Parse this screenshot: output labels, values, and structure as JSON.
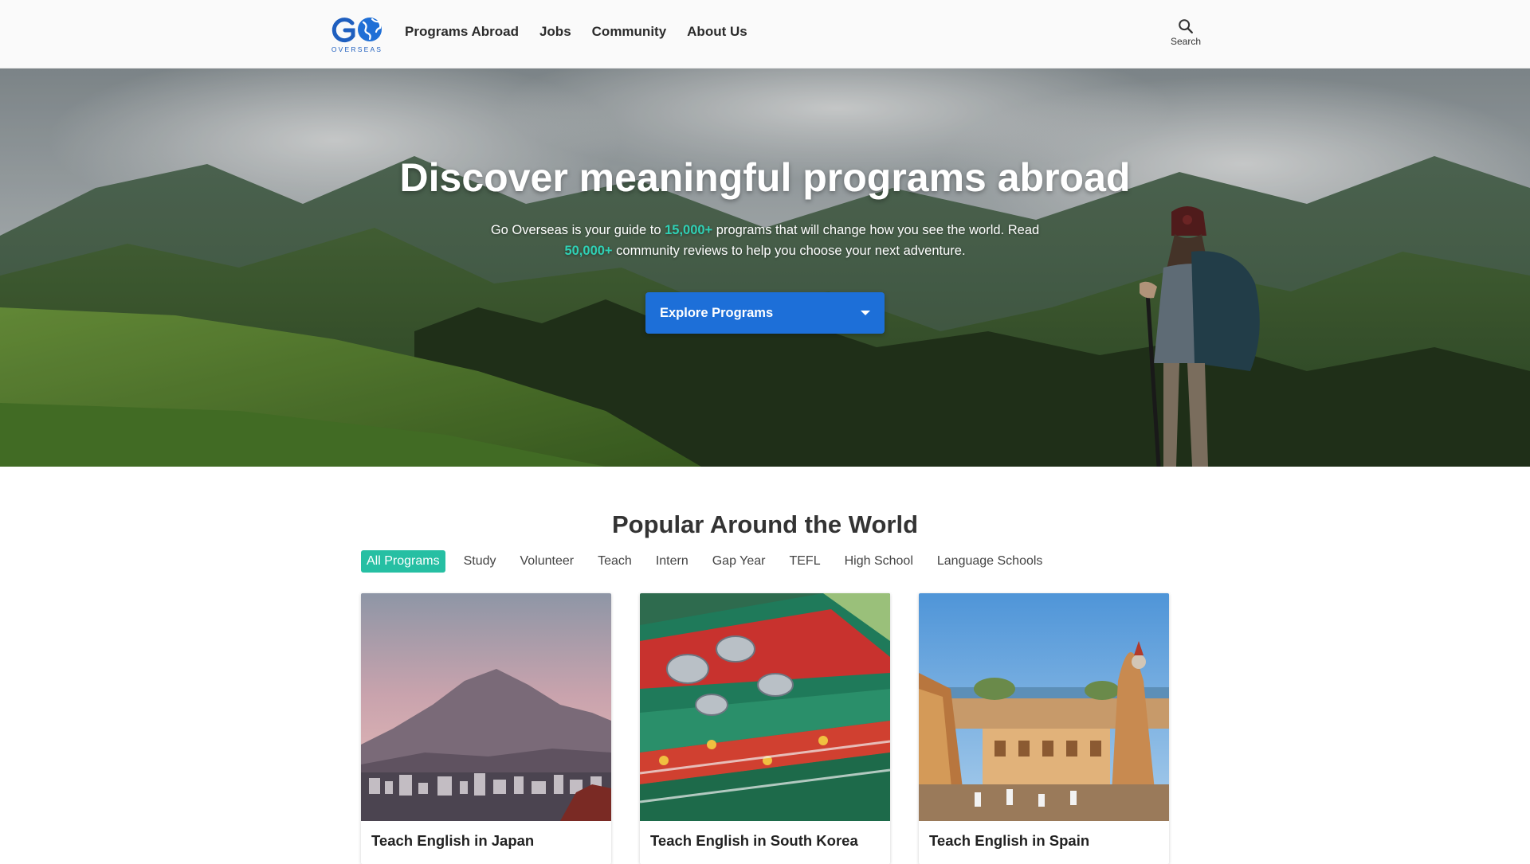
{
  "brand": {
    "logo_letters": "GO",
    "logo_subtext": "OVERSEAS",
    "primary_color": "#1d6fd8",
    "accent_color": "#26bfa3"
  },
  "nav": {
    "items": [
      {
        "label": "Programs Abroad"
      },
      {
        "label": "Jobs"
      },
      {
        "label": "Community"
      },
      {
        "label": "About Us"
      }
    ],
    "search_label": "Search",
    "search_icon": "search-icon"
  },
  "hero": {
    "title": "Discover meaningful programs abroad",
    "sub_part1": "Go Overseas is your guide to ",
    "highlight_programs": "15,000+",
    "sub_part2": " programs that will change how you see the world. Read ",
    "highlight_reviews": "50,000+",
    "sub_part3": " community reviews to help you choose your next adventure.",
    "button_label": "Explore Programs",
    "button_icon": "caret-down-icon"
  },
  "popular": {
    "title": "Popular Around the World",
    "tabs": [
      {
        "label": "All Programs",
        "active": true
      },
      {
        "label": "Study"
      },
      {
        "label": "Volunteer"
      },
      {
        "label": "Teach"
      },
      {
        "label": "Intern"
      },
      {
        "label": "Gap Year"
      },
      {
        "label": "TEFL"
      },
      {
        "label": "High School"
      },
      {
        "label": "Language Schools"
      }
    ],
    "cards": [
      {
        "title": "Teach English in Japan"
      },
      {
        "title": "Teach English in South Korea"
      },
      {
        "title": "Teach English in Spain"
      }
    ]
  }
}
